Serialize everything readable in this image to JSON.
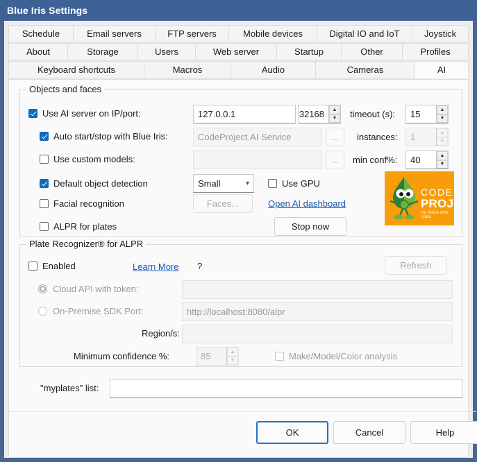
{
  "window": {
    "title": "Blue Iris Settings",
    "titlebar_color": "#3f6296",
    "frame_color": "#4a6591"
  },
  "tabs": {
    "rows": [
      [
        {
          "label": "Schedule",
          "active": false,
          "width": 93
        },
        {
          "label": "Email servers",
          "active": false,
          "width": 118
        },
        {
          "label": "FTP servers",
          "active": false,
          "width": 106
        },
        {
          "label": "Mobile devices",
          "active": false,
          "width": 127
        },
        {
          "label": "Digital IO and IoT",
          "active": false,
          "width": 137
        },
        {
          "label": "Joystick",
          "active": false,
          "width": 82
        }
      ],
      [
        {
          "label": "About",
          "active": false,
          "width": 85
        },
        {
          "label": "Storage",
          "active": false,
          "width": 101
        },
        {
          "label": "Users",
          "active": false,
          "width": 83
        },
        {
          "label": "Web server",
          "active": false,
          "width": 117
        },
        {
          "label": "Startup",
          "active": false,
          "width": 93
        },
        {
          "label": "Other",
          "active": false,
          "width": 88
        },
        {
          "label": "Profiles",
          "active": false,
          "width": 96
        }
      ],
      [
        {
          "label": "Keyboard shortcuts",
          "active": false,
          "width": 195
        },
        {
          "label": "Macros",
          "active": false,
          "width": 125
        },
        {
          "label": "Audio",
          "active": false,
          "width": 122
        },
        {
          "label": "Cameras",
          "active": false,
          "width": 143
        },
        {
          "label": "AI",
          "active": true,
          "width": 78
        }
      ]
    ]
  },
  "objects_group": {
    "title": "Objects and faces",
    "use_ai_server": {
      "label": "Use AI server on IP/port:",
      "checked": true
    },
    "ip_value": "127.0.0.1",
    "port_value": "32168",
    "timeout_label": "timeout (s):",
    "timeout_value": "15",
    "auto_start": {
      "label": "Auto start/stop with Blue Iris:",
      "checked": true
    },
    "service_value": "CodeProject.AI Service",
    "service_browse_label": "...",
    "instances_label": "instances:",
    "instances_value": "1",
    "custom_models": {
      "label": "Use custom models:",
      "checked": false
    },
    "custom_models_value": "",
    "custom_browse_label": "...",
    "min_conf_label": "min conf%:",
    "min_conf_value": "40",
    "default_detection": {
      "label": "Default object detection",
      "checked": true
    },
    "model_size_value": "Small",
    "model_size_chevron": "chevron-down-icon",
    "use_gpu": {
      "label": "Use GPU",
      "checked": false
    },
    "facial_recognition": {
      "label": "Facial recognition",
      "checked": false
    },
    "faces_button_label": "Faces...",
    "dashboard_link": "Open AI dashboard",
    "alpr_plates": {
      "label": "ALPR for plates",
      "checked": false
    },
    "stop_now_label": "Stop now",
    "logo": {
      "brand_top": "CODE",
      "brand_bottom": "PROJECT",
      "registered": "®",
      "tagline": "for those who code",
      "bg_color": "#f79d0c"
    }
  },
  "plate_group": {
    "title": "Plate Recognizer® for ALPR",
    "enabled": {
      "label": "Enabled",
      "checked": false
    },
    "learn_more": "Learn More",
    "help_glyph": "?",
    "refresh_label": "Refresh",
    "cloud_api": {
      "label": "Cloud API with token:",
      "selected": true
    },
    "cloud_api_value": "",
    "on_premise": {
      "label": "On-Premise SDK Port:",
      "selected": false
    },
    "on_premise_value": "http://localhost:8080/alpr",
    "regions_label": "Region/s:",
    "regions_value": "",
    "min_conf_label": "Minimum confidence %:",
    "min_conf_value": "85",
    "make_model_color": {
      "label": "Make/Model/Color analysis",
      "checked": false
    }
  },
  "myplates": {
    "label": "\"myplates\" list:",
    "value": ""
  },
  "footer": {
    "ok": "OK",
    "cancel": "Cancel",
    "help": "Help"
  }
}
